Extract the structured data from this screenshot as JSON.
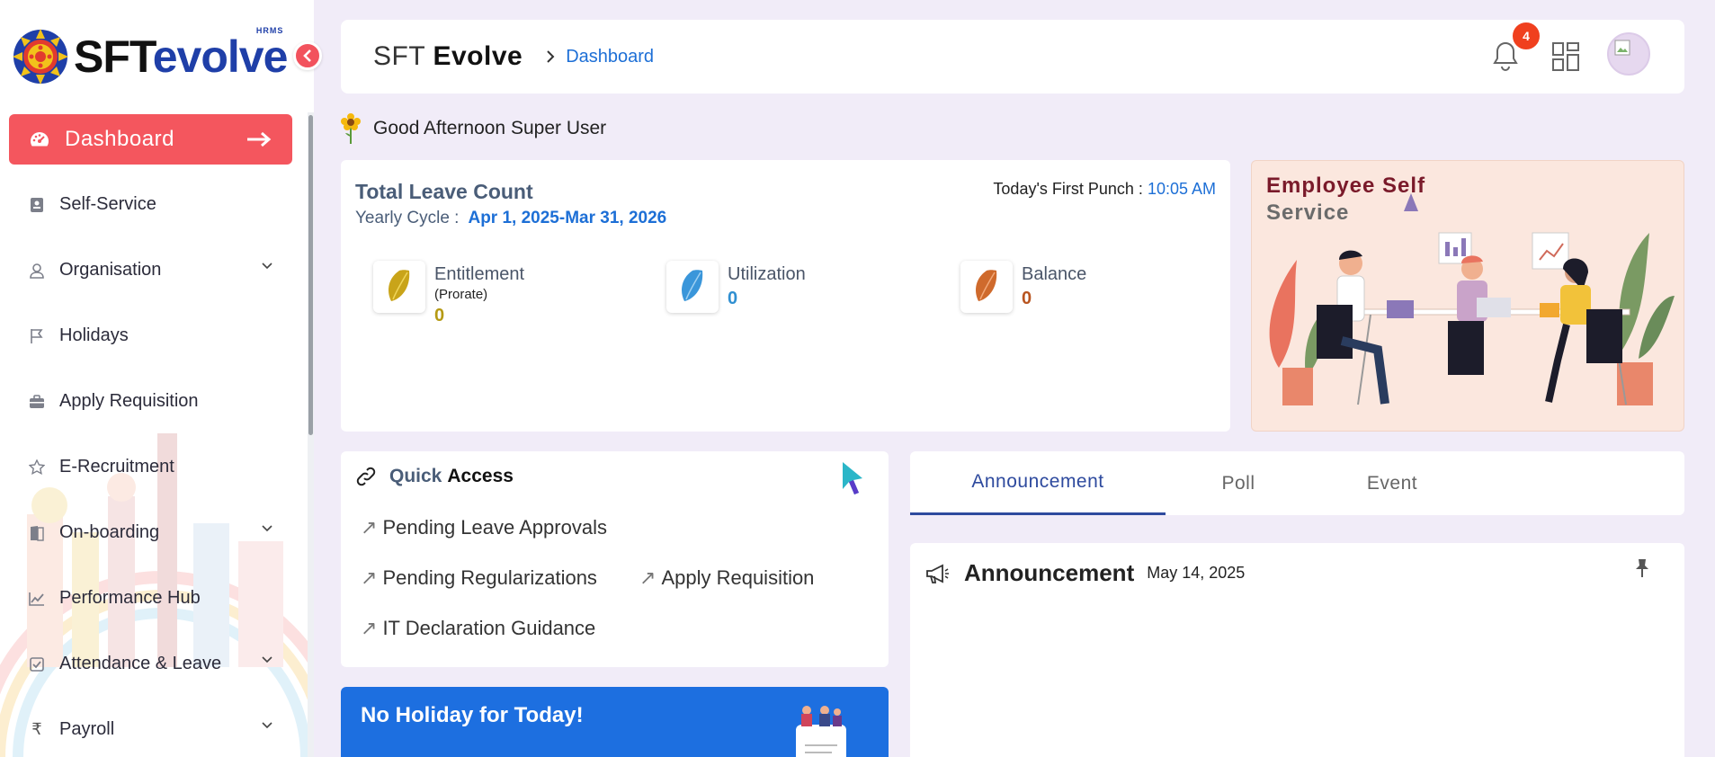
{
  "logo": {
    "brand_sft": "SFT",
    "brand_evolve": "evolve",
    "tagline": "HRMS"
  },
  "sidebar": {
    "items": [
      {
        "label": "Dashboard",
        "icon": "dashboard-gauge-icon",
        "active": true
      },
      {
        "label": "Self-Service",
        "icon": "id-card-icon"
      },
      {
        "label": "Organisation",
        "icon": "user-icon",
        "expandable": true
      },
      {
        "label": "Holidays",
        "icon": "flag-icon"
      },
      {
        "label": "Apply Requisition",
        "icon": "briefcase-icon"
      },
      {
        "label": "E-Recruitment",
        "icon": "star-icon"
      },
      {
        "label": "On-boarding",
        "icon": "door-icon",
        "expandable": true
      },
      {
        "label": "Performance Hub",
        "icon": "chart-line-icon"
      },
      {
        "label": "Attendance & Leave",
        "icon": "checkbox-icon",
        "expandable": true
      },
      {
        "label": "Payroll",
        "icon": "rupee-icon",
        "expandable": true
      }
    ]
  },
  "header": {
    "title_light": "SFT",
    "title_bold": "Evolve",
    "breadcrumb": "Dashboard",
    "notification_count": "4"
  },
  "greeting": "Good Afternoon Super User",
  "leave": {
    "title": "Total Leave Count",
    "cycle_label": "Yearly Cycle :",
    "cycle_value": "Apr 1, 2025-Mar 31, 2026",
    "punch_label": "Today's First Punch :",
    "punch_value": "10:05 AM",
    "stats": [
      {
        "label": "Entitlement",
        "sub": "(Prorate)",
        "value": "0",
        "color": "#b59a14"
      },
      {
        "label": "Utilization",
        "value": "0",
        "color": "#2f8fd1"
      },
      {
        "label": "Balance",
        "value": "0",
        "color": "#b8541f"
      }
    ]
  },
  "ess": {
    "line1": "Employee Self",
    "line2": "Service"
  },
  "quick_access": {
    "title_q": "Quick",
    "title_a": "Access",
    "links": [
      "Pending Leave Approvals",
      "Pending Regularizations",
      "Apply Requisition",
      "IT Declaration Guidance"
    ]
  },
  "holiday": {
    "text": "No Holiday for Today!"
  },
  "tabs": [
    {
      "label": "Announcement",
      "active": true
    },
    {
      "label": "Poll"
    },
    {
      "label": "Event"
    }
  ],
  "announcement": {
    "title": "Announcement",
    "date": "May 14, 2025"
  },
  "colors": {
    "accent": "#f4565e",
    "link": "#1d6fd6",
    "background": "#f1ecf8",
    "holiday": "#1d6fe0"
  }
}
